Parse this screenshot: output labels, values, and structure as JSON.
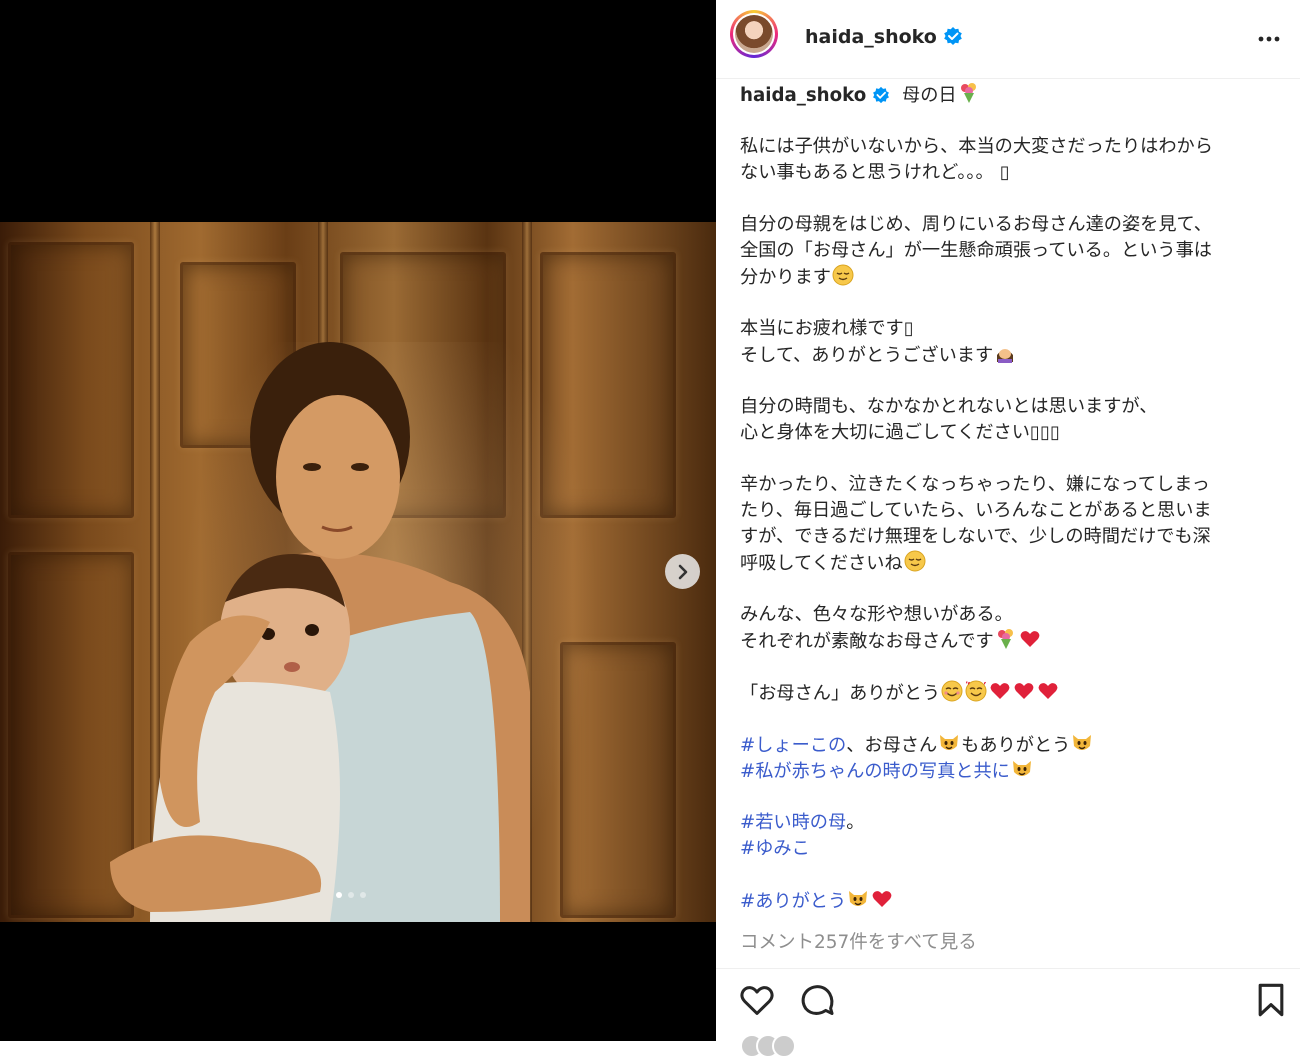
{
  "header": {
    "username": "haida_shoko",
    "verified_icon": "verified-badge-icon",
    "more_icon": "more-options-icon"
  },
  "media": {
    "next_icon": "chevron-right-icon",
    "carousel": {
      "count": 3,
      "active_index": 0
    }
  },
  "caption": {
    "username": "haida_shoko",
    "title": "母の日",
    "lines": {
      "l1": "私には子供がいないから、本当の大変さだったりはわから",
      "l2": "ない事もあると思うけれど。。。",
      "l3": "自分の母親をはじめ、周りにいるお母さん達の姿を見て、",
      "l4": "全国の「お母さん」が一生懸命頑張っている。という事は",
      "l5": "分かります",
      "l6": "本当にお疲れ様です",
      "l7": "そして、ありがとうございます",
      "l8": "自分の時間も、なかなかとれないとは思いますが、",
      "l9": "心と身体を大切に過ごしてください",
      "l10": "辛かったり、泣きたくなっちゃったり、嫌になってしまっ",
      "l11": "たり、毎日過ごしていたら、いろんなことがあると思いま",
      "l12": "すが、できるだけ無理をしないで、少しの時間だけでも深",
      "l13": "呼吸してくださいね",
      "l14": "みんな、色々な形や想いがある。",
      "l15": "それぞれが素敵なお母さんです",
      "l16": "「お母さん」ありがとう",
      "l17_tag": "#しょーこの",
      "l17_text": "、お母さん",
      "l17_text2": "もありがとう",
      "l18_tag": "#私が赤ちゃんの時の写真と共に",
      "l19_tag": "#若い時の母",
      "l19_text": "。",
      "l20_tag": "#ゆみこ",
      "l21_tag": "#ありがとう"
    },
    "unknown_glyph": "▯",
    "emoji": {
      "bouquet": "bouquet-emoji",
      "relieved": "relieved-face-emoji",
      "bowing": "bowing-woman-emoji",
      "heart": "red-heart-emoji",
      "smile": "smiling-face-emoji",
      "hearts_face": "smiling-face-with-hearts-emoji",
      "cat": "cat-face-emoji"
    }
  },
  "comments": {
    "view_all": "コメント257件をすべて見る"
  },
  "actions": {
    "like_icon": "heart-outline-icon",
    "comment_icon": "comment-bubble-icon",
    "save_icon": "bookmark-icon"
  },
  "colors": {
    "hashtag": "#3b5ccc",
    "verified": "#0095f6",
    "secondary_text": "#8e8e8e"
  }
}
